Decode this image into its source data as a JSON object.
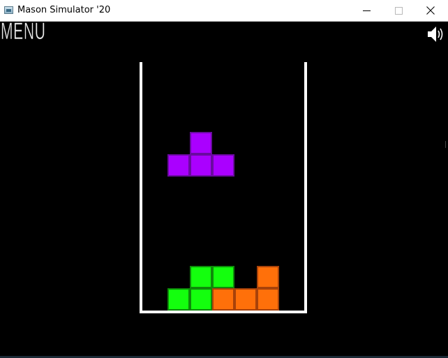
{
  "window": {
    "title": "Mason Simulator '20",
    "icon": "app-window-icon",
    "controls": [
      "minimize",
      "maximize",
      "close"
    ]
  },
  "game": {
    "menu_label": "MENU",
    "sound_icon": "speaker-icon",
    "colors": {
      "background": "#000000",
      "well": "#ffffff",
      "active_piece": "#aa00ff",
      "green_blocks": "#14ff0e",
      "orange_blocks": "#ff700a"
    },
    "active_piece": {
      "shape": "T",
      "color": "purple"
    },
    "stacked_pieces": [
      {
        "shape": "S",
        "color": "green"
      },
      {
        "shape": "L",
        "color": "orange"
      }
    ]
  }
}
